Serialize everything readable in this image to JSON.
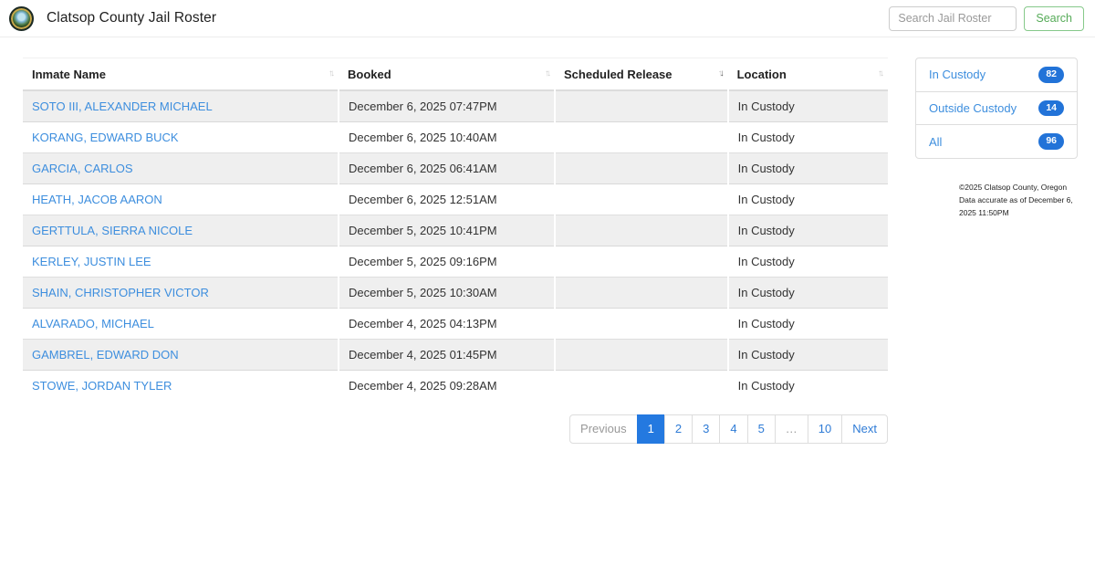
{
  "header": {
    "title": "Clatsop County Jail Roster",
    "search_placeholder": "Search Jail Roster",
    "search_button": "Search"
  },
  "table": {
    "columns": [
      {
        "label": "Inmate Name",
        "sort": "none"
      },
      {
        "label": "Booked",
        "sort": "none"
      },
      {
        "label": "Scheduled Release",
        "sort": "desc"
      },
      {
        "label": "Location",
        "sort": "none"
      }
    ],
    "rows": [
      {
        "name": "SOTO III, ALEXANDER MICHAEL",
        "booked": "December 6, 2025 07:47PM",
        "scheduled_release": "",
        "location": "In Custody"
      },
      {
        "name": "KORANG, EDWARD BUCK",
        "booked": "December 6, 2025 10:40AM",
        "scheduled_release": "",
        "location": "In Custody"
      },
      {
        "name": "GARCIA, CARLOS",
        "booked": "December 6, 2025 06:41AM",
        "scheduled_release": "",
        "location": "In Custody"
      },
      {
        "name": "HEATH, JACOB AARON",
        "booked": "December 6, 2025 12:51AM",
        "scheduled_release": "",
        "location": "In Custody"
      },
      {
        "name": "GERTTULA, SIERRA NICOLE",
        "booked": "December 5, 2025 10:41PM",
        "scheduled_release": "",
        "location": "In Custody"
      },
      {
        "name": "KERLEY, JUSTIN LEE",
        "booked": "December 5, 2025 09:16PM",
        "scheduled_release": "",
        "location": "In Custody"
      },
      {
        "name": "SHAIN, CHRISTOPHER VICTOR",
        "booked": "December 5, 2025 10:30AM",
        "scheduled_release": "",
        "location": "In Custody"
      },
      {
        "name": "ALVARADO, MICHAEL",
        "booked": "December 4, 2025 04:13PM",
        "scheduled_release": "",
        "location": "In Custody"
      },
      {
        "name": "GAMBREL, EDWARD DON",
        "booked": "December 4, 2025 01:45PM",
        "scheduled_release": "",
        "location": "In Custody"
      },
      {
        "name": "STOWE, JORDAN TYLER",
        "booked": "December 4, 2025 09:28AM",
        "scheduled_release": "",
        "location": "In Custody"
      }
    ]
  },
  "pagination": {
    "items": [
      {
        "label": "Previous",
        "state": "disabled",
        "name": "pagination-previous"
      },
      {
        "label": "1",
        "state": "active",
        "name": "pagination-page-1"
      },
      {
        "label": "2",
        "state": "link",
        "name": "pagination-page-2"
      },
      {
        "label": "3",
        "state": "link",
        "name": "pagination-page-3"
      },
      {
        "label": "4",
        "state": "link",
        "name": "pagination-page-4"
      },
      {
        "label": "5",
        "state": "link",
        "name": "pagination-page-5"
      },
      {
        "label": "…",
        "state": "disabled",
        "name": "pagination-ellipsis"
      },
      {
        "label": "10",
        "state": "link",
        "name": "pagination-page-10"
      },
      {
        "label": "Next",
        "state": "link",
        "name": "pagination-next"
      }
    ]
  },
  "sidebar": {
    "items": [
      {
        "label": "In Custody",
        "count": "82",
        "name": "sidebar-item-in-custody"
      },
      {
        "label": "Outside Custody",
        "count": "14",
        "name": "sidebar-item-outside-custody"
      },
      {
        "label": "All",
        "count": "96",
        "name": "sidebar-item-all"
      }
    ]
  },
  "footer": {
    "line1": "©2025 Clatsop County, Oregon",
    "line2": "Data accurate as of December 6, 2025 11:50PM"
  },
  "colors": {
    "accent_link": "#3d8ede",
    "pagination_active": "#2479e0",
    "badge_blue": "#2273d8",
    "button_green": "#56ab58",
    "row_stripe": "#efefef"
  }
}
